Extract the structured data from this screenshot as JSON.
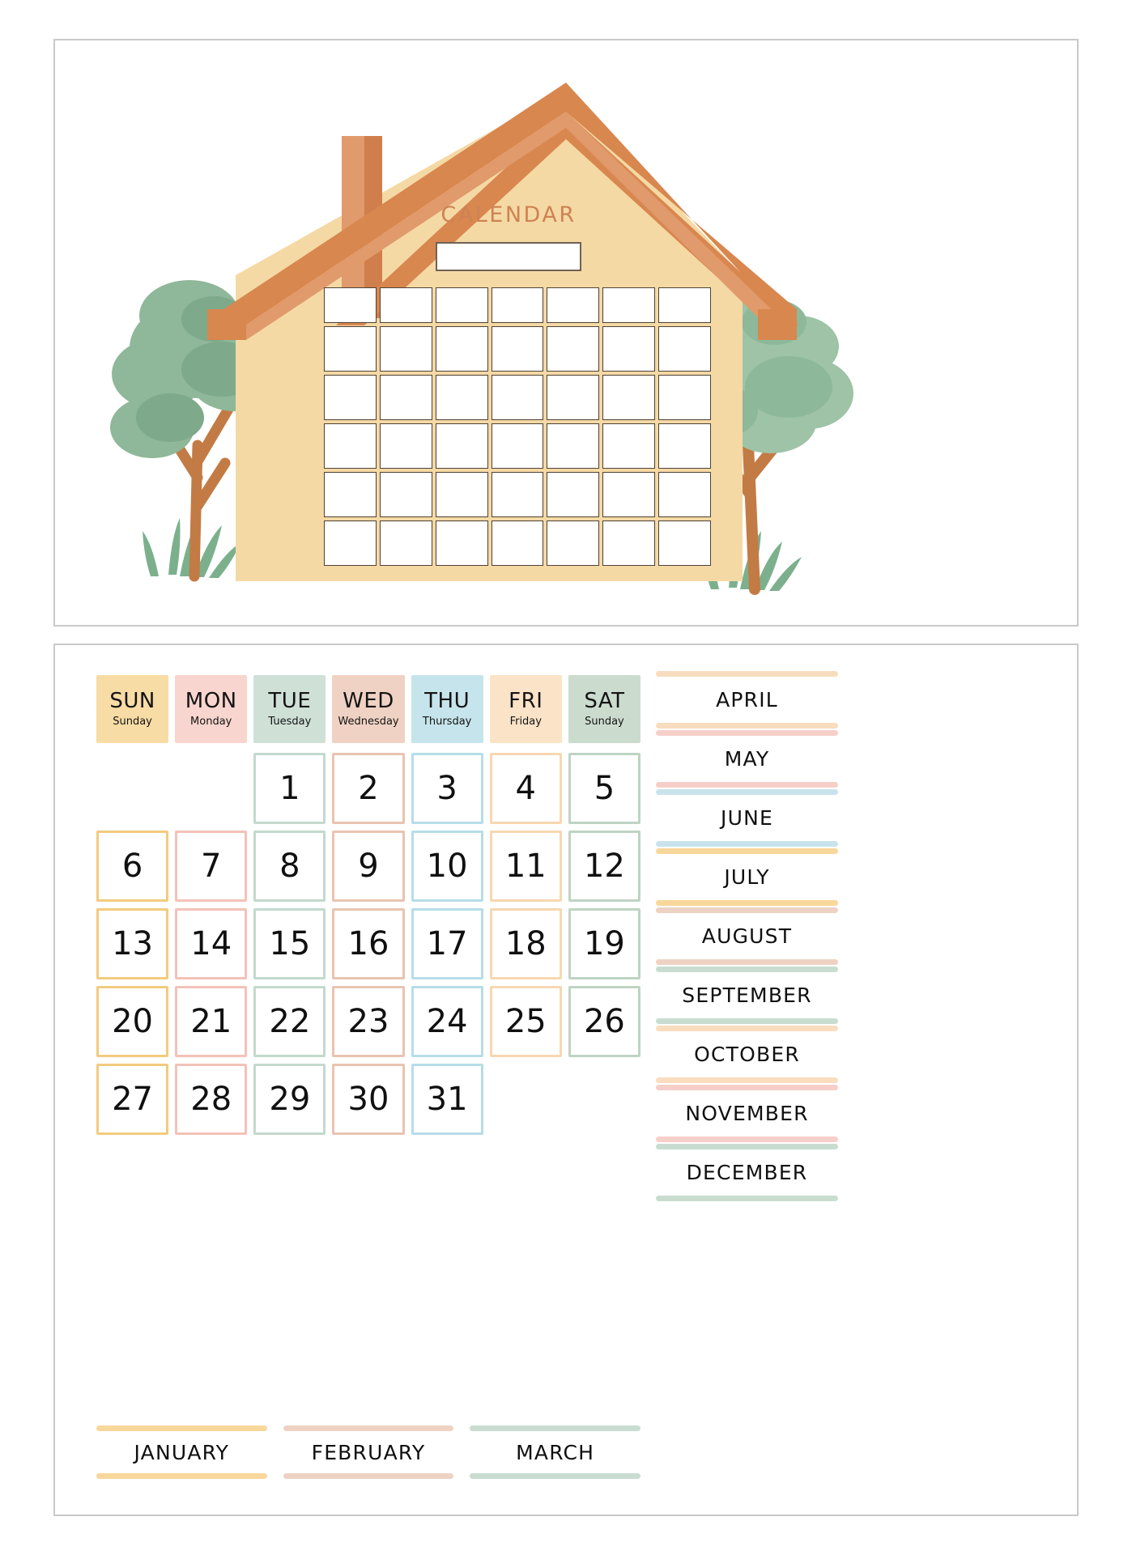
{
  "document": {
    "title_text": "CALENDAR",
    "panels": [
      "house-calendar-template",
      "cutout-pieces"
    ]
  },
  "house_panel": {
    "title": "CALENDAR",
    "title_color": "#cd8353",
    "name_box_value": "",
    "house_body_color": "#f5d9a4",
    "roof_color": "#d8874f",
    "roof_inner_color": "#e09a6b",
    "chimney_color": "#e09a6b",
    "chimney_shade_color": "#cf7e4c",
    "tree_foliage_color": "#8fb79a",
    "tree_foliage_shade": "#7ea98b",
    "tree_trunk_color": "#c37b45",
    "grass_color": "#7cb08d",
    "grid_cell_border": "#4e4236",
    "grid_columns": 7,
    "grid_rows": 6
  },
  "weekdays": [
    {
      "abbr": "SUN",
      "full": "Sunday",
      "bg": "#f8dca5",
      "border": "#f3cb7f"
    },
    {
      "abbr": "MON",
      "full": "Monday",
      "bg": "#f8d5ce",
      "border": "#f3c2b8"
    },
    {
      "abbr": "TUE",
      "full": "Tuesday",
      "bg": "#cfe0d7",
      "border": "#c3dacd"
    },
    {
      "abbr": "WED",
      "full": "Wednesday",
      "bg": "#efd2c3",
      "border": "#e9c4b1"
    },
    {
      "abbr": "THU",
      "full": "Thursday",
      "bg": "#c6e4ec",
      "border": "#b6dde8"
    },
    {
      "abbr": "FRI",
      "full": "Friday",
      "bg": "#fbe3c8",
      "border": "#f7d7b1"
    },
    {
      "abbr": "SAT",
      "full": "Sunday",
      "bg": "#cbdcce",
      "border": "#bfd4c3"
    }
  ],
  "dates": {
    "start_weekday_index": 2,
    "days": [
      1,
      2,
      3,
      4,
      5,
      6,
      7,
      8,
      9,
      10,
      11,
      12,
      13,
      14,
      15,
      16,
      17,
      18,
      19,
      20,
      21,
      22,
      23,
      24,
      25,
      26,
      27,
      28,
      29,
      30,
      31
    ],
    "total_days": 31
  },
  "months_right": [
    {
      "label": "APRIL",
      "color": "#f8dcbe"
    },
    {
      "label": "MAY",
      "color": "#f6cfc9"
    },
    {
      "label": "JUNE",
      "color": "#c9e3ec"
    },
    {
      "label": "JULY",
      "color": "#f8d79a"
    },
    {
      "label": "AUGUST",
      "color": "#eed2c3"
    },
    {
      "label": "SEPTEMBER",
      "color": "#c9dcd0"
    },
    {
      "label": "OCTOBER",
      "color": "#f9ddbe"
    },
    {
      "label": "NOVEMBER",
      "color": "#f6cfc9"
    },
    {
      "label": "DECEMBER",
      "color": "#c9dcd0"
    }
  ],
  "months_bottom": [
    {
      "label": "JANUARY",
      "color": "#f8d79a"
    },
    {
      "label": "FEBRUARY",
      "color": "#eed2c3"
    },
    {
      "label": "MARCH",
      "color": "#c9dcd0"
    }
  ]
}
